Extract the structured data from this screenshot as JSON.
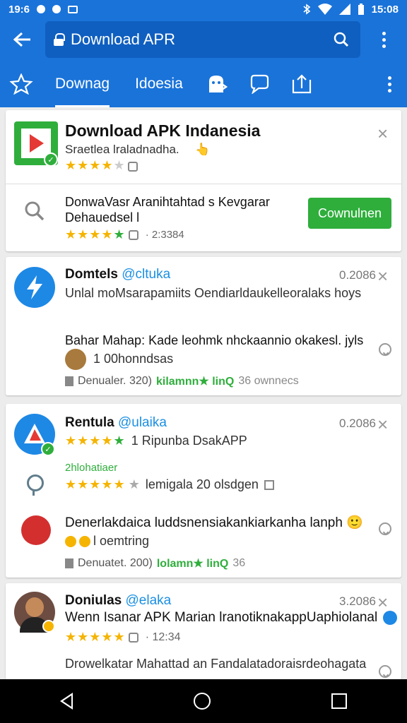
{
  "status": {
    "time_left": "19:6",
    "time_right": "15:08"
  },
  "search": {
    "query": "Download APR"
  },
  "tabs": [
    {
      "label": "Downag"
    },
    {
      "label": "Idoesia"
    }
  ],
  "colors": {
    "primary": "#1a73d9",
    "green": "#2fae3c",
    "star": "#f5b400"
  },
  "top_card": {
    "title": "Download APK Indanesia",
    "subtitle": "Sraetlea lraladnadha.",
    "rating": 4,
    "row2_title": "DonwaVasr Aranihtahtad s Kevgarar",
    "row2_subtitle": "Dehauedsel l",
    "row2_meta": "· 2:3384",
    "button_label": "Cownulnen"
  },
  "card1": {
    "name": "Domtels",
    "handle": "@cltuka",
    "time": "0.2086",
    "text": "Unlal moMsarapamiits Oendiarldaukelleoralaks hoys",
    "title": "Bahar Mahap: Kade leohmk nhckaannio okakesl. jyls",
    "sub": "1 00honndsas",
    "meta_left": "Denualer. 320)",
    "meta_green": "kilamnn★ linQ",
    "meta_right": "36 ownnecs"
  },
  "card2": {
    "name": "Rentula",
    "handle": "@ulaika",
    "time": "0.2086",
    "line1": "1 Ripunba DsakAPP",
    "green_label": "2hlohatiaer",
    "line2": "lemigala 20 olsdgen",
    "title": "Denerlakdaica luddsnensiakankiarkanha lanph",
    "sub": "l oemtring",
    "meta_left": "Denuatet. 200)",
    "meta_green": "lolamn★ linQ",
    "meta_right": "36"
  },
  "card3": {
    "name": "Doniulas",
    "handle": "@elaka",
    "time": "3.2086",
    "line1": "Wenn Isanar APK Marian lranotiknakappUaphiolanal",
    "meta": "· 12:34",
    "line2": "Drowelkatar Mahattad an Fandalatadoraisrdeohagata"
  }
}
